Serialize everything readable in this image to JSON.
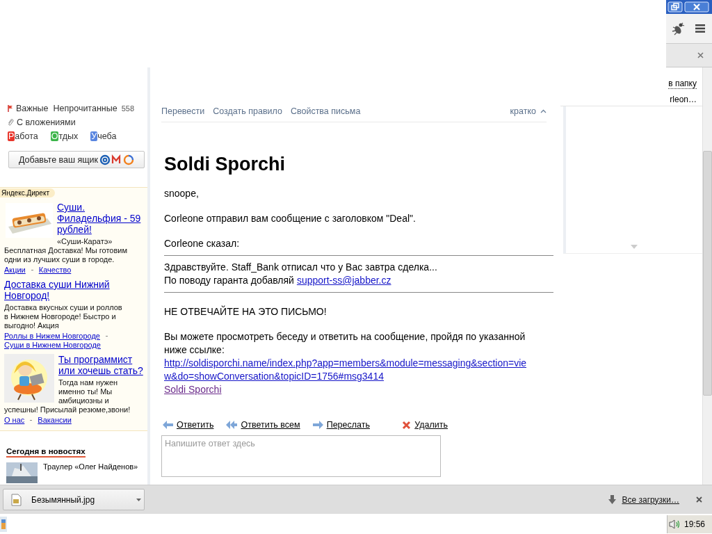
{
  "right_panel": {
    "texts": [
      "в папку",
      "rleon…"
    ]
  },
  "sidebar": {
    "filters": [
      {
        "kind": "flag",
        "label": "Важные"
      },
      {
        "kind": "plain",
        "label": "Непрочитанные",
        "count": "558"
      },
      {
        "kind": "attachment",
        "label": "С вложениями"
      }
    ],
    "labels": [
      {
        "letter": "Р",
        "rest": "абота",
        "color": "#e8352b"
      },
      {
        "letter": "О",
        "rest": "тдых",
        "color": "#3cb54a"
      },
      {
        "letter": "У",
        "rest": "чеба",
        "color": "#5a86e0"
      }
    ],
    "add_mailbox_button": "Добавьте ваш ящик",
    "direct": {
      "title": "Яндекс.Директ",
      "ads": [
        {
          "kind": "picture",
          "headline": "Суши. Филадельфия - 59 рублей!",
          "text": "«Суши-Каратэ» Бесплатная Доставка! Мы готовим одни из лучших суши в городе.",
          "links": [
            "Акции",
            "Качество"
          ]
        },
        {
          "kind": "text",
          "headline": "Доставка суши Нижний Новгород!",
          "text": "Доставка вкусных суши и роллов в Нижнем Новгороде! Быстро и выгодно! Акция",
          "links": [
            "Роллы в Нижем Новгороде",
            "Суши в Нижнем Новгороде"
          ]
        },
        {
          "kind": "picture",
          "headline": "Ты программист или хочешь стать?",
          "text": "Тогда нам нужен именно ты! Мы амбициозны и успешны! Присылай резюме,звони!",
          "links": [
            "О нас",
            "Вакансии"
          ]
        }
      ]
    },
    "news": {
      "title": "Сегодня в новостях",
      "items": [
        {
          "text": "Траулер «Олег Найденов»"
        }
      ]
    }
  },
  "mail": {
    "toolbar": [
      "Перевести",
      "Создать правило",
      "Свойства письма"
    ],
    "view_toggle": {
      "label": "кратко",
      "expanded": true
    },
    "subject": "Soldi Sporchi",
    "body": [
      {
        "kind": "text",
        "text": "snoope,"
      },
      {
        "kind": "text",
        "text": "Corleone отправил вам сообщение с заголовком \"Deal\"."
      },
      {
        "kind": "text",
        "text": "Corleone сказал:"
      },
      {
        "kind": "quote",
        "lines": [
          {
            "text": "Здравствуйте. Staff_Bank отписал что у Вас завтра сделка..."
          },
          {
            "text": "По поводу гаранта добавляй",
            "link": "support-ss@jabber.cz"
          }
        ]
      },
      {
        "kind": "text",
        "text": "НЕ ОТВЕЧАЙТЕ НА ЭТО ПИСЬМО!"
      },
      {
        "kind": "text",
        "text": "Вы можете просмотреть беседу и ответить на сообщение, пройдя по указанной ниже ссылке:",
        "links": [
          {
            "text": "http://soldisporchi.name/index.php?app=members&module=messaging&section=view&do=showConversation&topicID=1756#msg3414",
            "visited": false
          },
          {
            "text": "Soldi Sporchi",
            "visited": true
          }
        ]
      }
    ],
    "actions": [
      {
        "kind": "reply",
        "label": "Ответить"
      },
      {
        "kind": "reply-all",
        "label": "Ответить всем"
      },
      {
        "kind": "forward",
        "label": "Переслать"
      },
      {
        "kind": "delete",
        "label": "Удалить"
      }
    ],
    "reply_placeholder": "Напишите ответ здесь"
  },
  "downloads": {
    "file": "Безымянный.jpg",
    "all_link": "Все загрузки…"
  },
  "taskbar": {
    "clock": "19:56"
  }
}
